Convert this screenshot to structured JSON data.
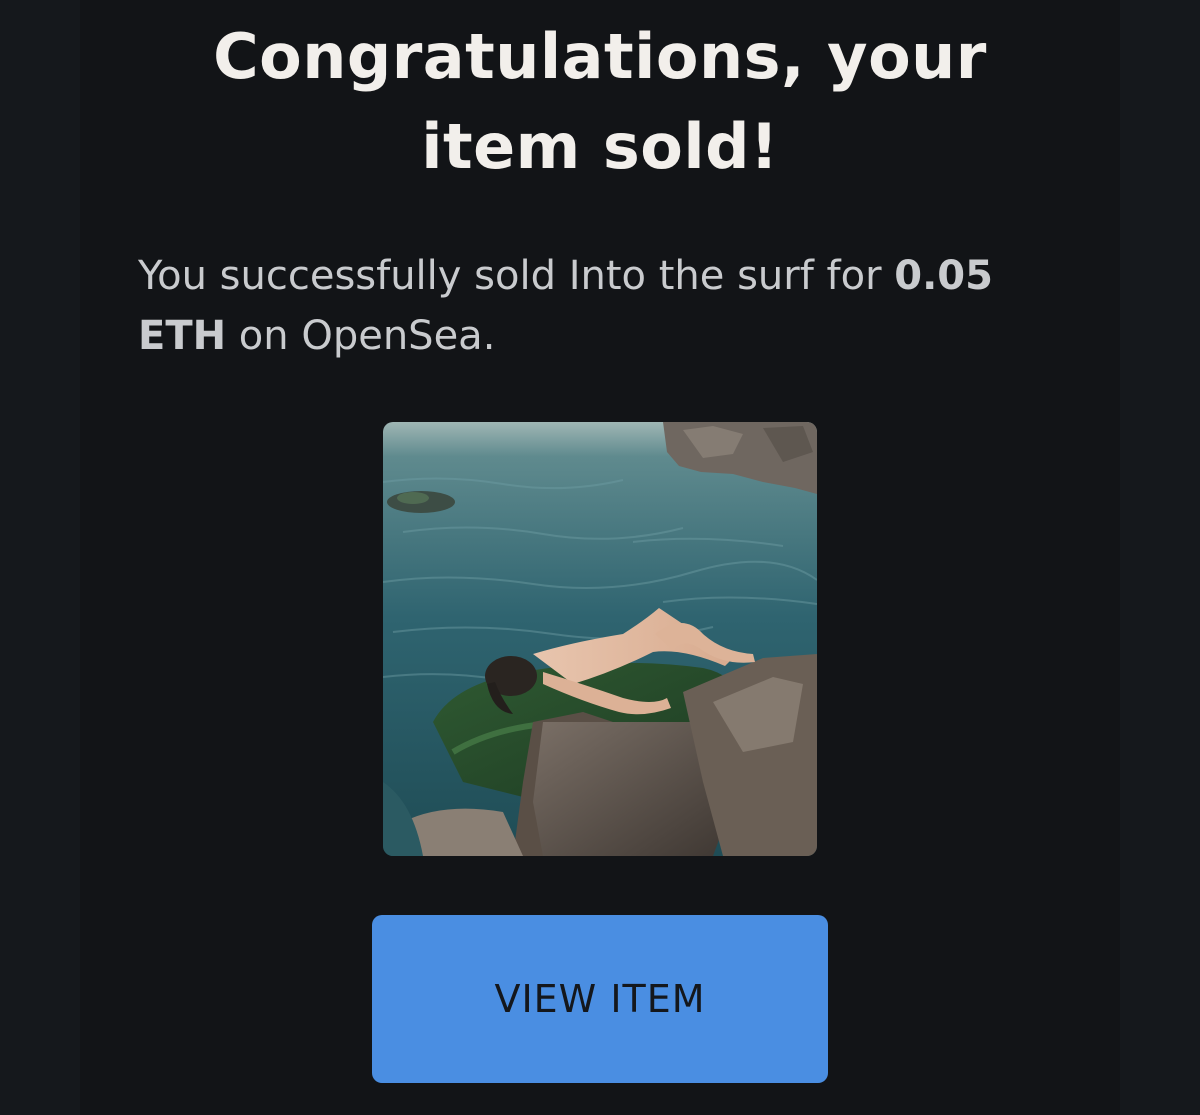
{
  "email": {
    "headline_line1": "Congratulations, your",
    "headline_line2": "item sold!",
    "message": {
      "before_item": "You successfully sold ",
      "item_name": "Into the surf",
      "middle": " for ",
      "price": "0.05 ETH",
      "after_price": " on OpenSea."
    },
    "item_image": {
      "icon": "item-photo"
    },
    "view_button_label": "VIEW ITEM"
  },
  "colors": {
    "background": "#121417",
    "headline": "#f2efeb",
    "body_text": "#c9cbce",
    "button": "#4a8ee2",
    "button_text": "#14171c"
  }
}
